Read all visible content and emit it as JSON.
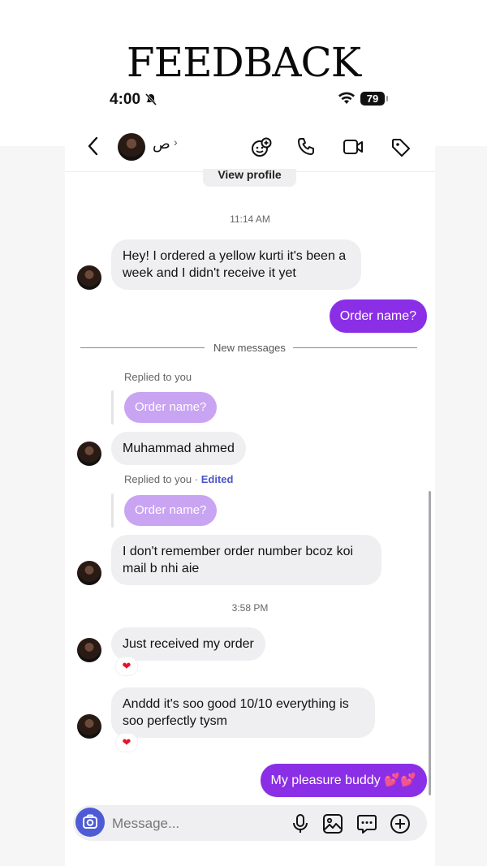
{
  "headline": "FEEDBACK",
  "status_bar": {
    "time": "4:00",
    "battery": "79"
  },
  "header": {
    "contact_name": "ص",
    "chevron": "›"
  },
  "icons": [
    "back-icon",
    "stickers-icon",
    "phone-icon",
    "video-icon",
    "tag-icon",
    "mute-icon",
    "wifi-icon",
    "camera-icon",
    "mic-icon",
    "gallery-icon",
    "sticker-chat-icon",
    "plus-icon",
    "heart-icon"
  ],
  "colors": {
    "accent": "#8b2fe6",
    "reply_bubble": "#c9a4f2",
    "incoming": "#efeff1",
    "camera_button": "#4f5bd5",
    "edited": "#4a55c8"
  },
  "view_profile": "View profile",
  "conversation": {
    "time1": "11:14 AM",
    "msg1": "Hey! I ordered a yellow kurti it's been a week and I didn't receive it yet",
    "msg2_out": "Order name?",
    "new_messages": "New messages",
    "reply1_label": "Replied to you",
    "reply1_quote": "Order name?",
    "msg3": "Muhammad ahmed",
    "reply2_label": "Replied to you",
    "reply2_sep": "·",
    "reply2_edited": "Edited",
    "reply2_quote": "Order name?",
    "msg4": "I don't remember order number bcoz koi mail b nhi aie",
    "time2": "3:58 PM",
    "msg5": "Just received my order",
    "msg5_reaction": "❤",
    "msg6": "Anddd it's soo good 10/10 everything is soo perfectly tysm",
    "msg6_reaction": "❤",
    "msg7_out": "My pleasure buddy 💕💕"
  },
  "composer": {
    "placeholder": "Message..."
  }
}
